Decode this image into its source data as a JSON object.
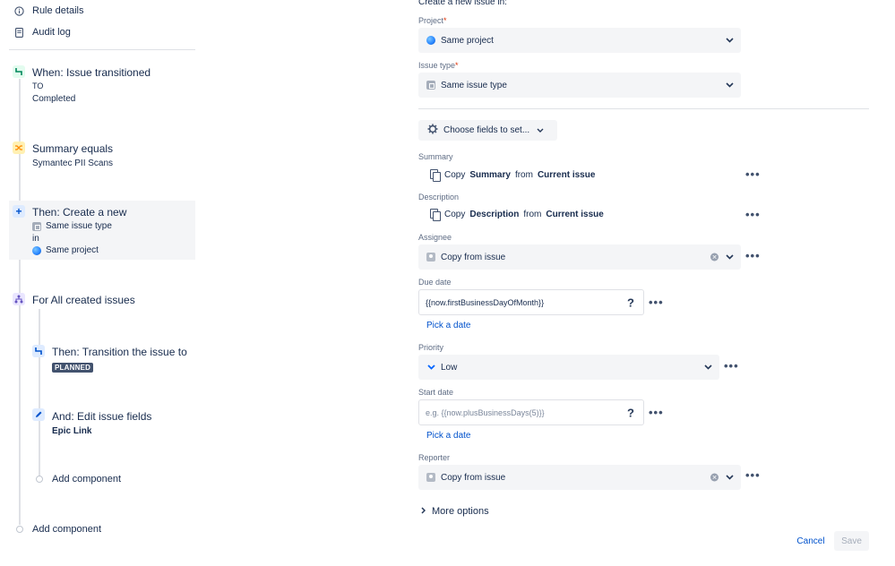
{
  "nav": {
    "rule_details": "Rule details",
    "audit_log": "Audit log"
  },
  "rule": {
    "trigger": {
      "title": "When: Issue transitioned",
      "to_label": "TO",
      "to_value": "Completed"
    },
    "condition": {
      "title": "Summary equals",
      "value": "Symantec PII Scans"
    },
    "action": {
      "title": "Then: Create a new",
      "issue_type": "Same issue type",
      "in_label": "in",
      "project": "Same project"
    },
    "branch": {
      "title": "For All created issues"
    },
    "transition": {
      "title": "Then: Transition the issue to",
      "status": "PLANNED"
    },
    "edit": {
      "title": "And: Edit issue fields",
      "field": "Epic Link"
    },
    "add_component_inner": "Add component",
    "add_component_outer": "Add component"
  },
  "form": {
    "header": "Create a new issue in:",
    "project_label": "Project",
    "project_value": "Same project",
    "issue_type_label": "Issue type",
    "issue_type_value": "Same issue type",
    "choose_fields": "Choose fields to set...",
    "summary_label": "Summary",
    "summary_copy": {
      "pre": "Copy",
      "field": "Summary",
      "mid": "from",
      "source": "Current issue"
    },
    "description_label": "Description",
    "description_copy": {
      "pre": "Copy",
      "field": "Description",
      "mid": "from",
      "source": "Current issue"
    },
    "assignee_label": "Assignee",
    "assignee_value": "Copy from issue",
    "due_date_label": "Due date",
    "due_date_value": "{{now.firstBusinessDayOfMonth}}",
    "pick_date_1": "Pick a date",
    "priority_label": "Priority",
    "priority_value": "Low",
    "start_date_label": "Start date",
    "start_date_placeholder": "e.g. {{now.plusBusinessDays(5)}}",
    "pick_date_2": "Pick a date",
    "reporter_label": "Reporter",
    "reporter_value": "Copy from issue",
    "more_options": "More options",
    "cancel": "Cancel",
    "save": "Save"
  },
  "colors": {
    "trigger_icon": "#36b37e",
    "condition_icon": "#ffab00",
    "action_icon": "#0052cc",
    "branch_icon": "#6554c0"
  }
}
